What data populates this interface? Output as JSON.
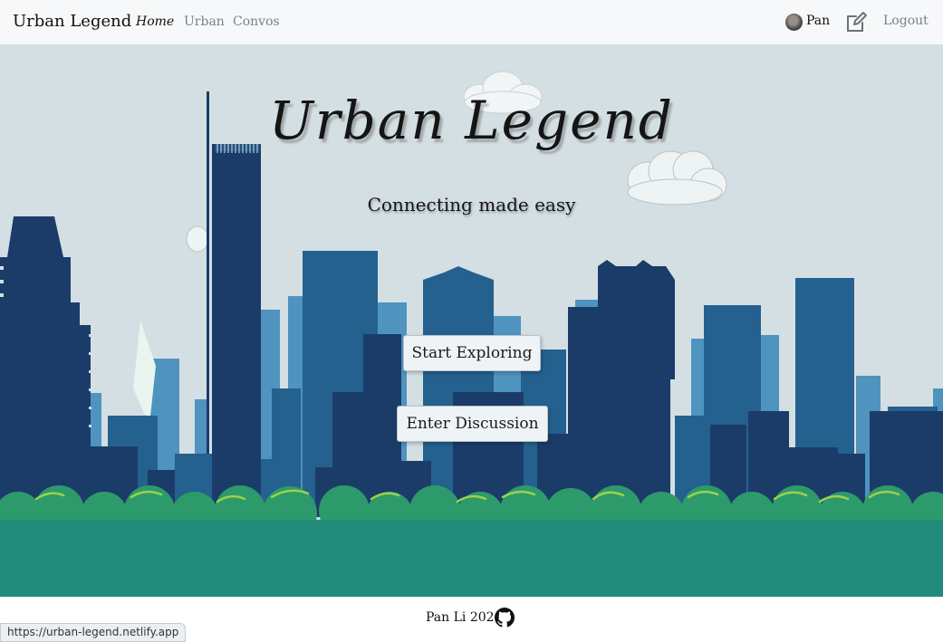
{
  "navbar": {
    "brand": "Urban Legend",
    "links": [
      {
        "label": "Home",
        "active": true
      },
      {
        "label": "Urban",
        "active": false
      },
      {
        "label": "Convos",
        "active": false
      }
    ],
    "user_name": "Pan",
    "logout_label": "Logout",
    "icons": {
      "avatar": "user-avatar",
      "edit": "edit-square-icon"
    }
  },
  "hero": {
    "title": "Urban Legend",
    "tagline": "Connecting made easy",
    "buttons": {
      "explore_label": "Start Exploring",
      "discuss_label": "Enter Discussion"
    },
    "colors": {
      "sky": "#d4dfe3",
      "building_dark": "#1b3c69",
      "building_mid": "#24618f",
      "building_light": "#4f93bf",
      "bush_green": "#2d9a6b",
      "ground": "#228c7c",
      "leaf_highlight": "#9bd24b"
    }
  },
  "footer": {
    "credit": "Pan Li 2021",
    "icon": "github-icon"
  },
  "status_bar": {
    "url": "https://urban-legend.netlify.app"
  }
}
